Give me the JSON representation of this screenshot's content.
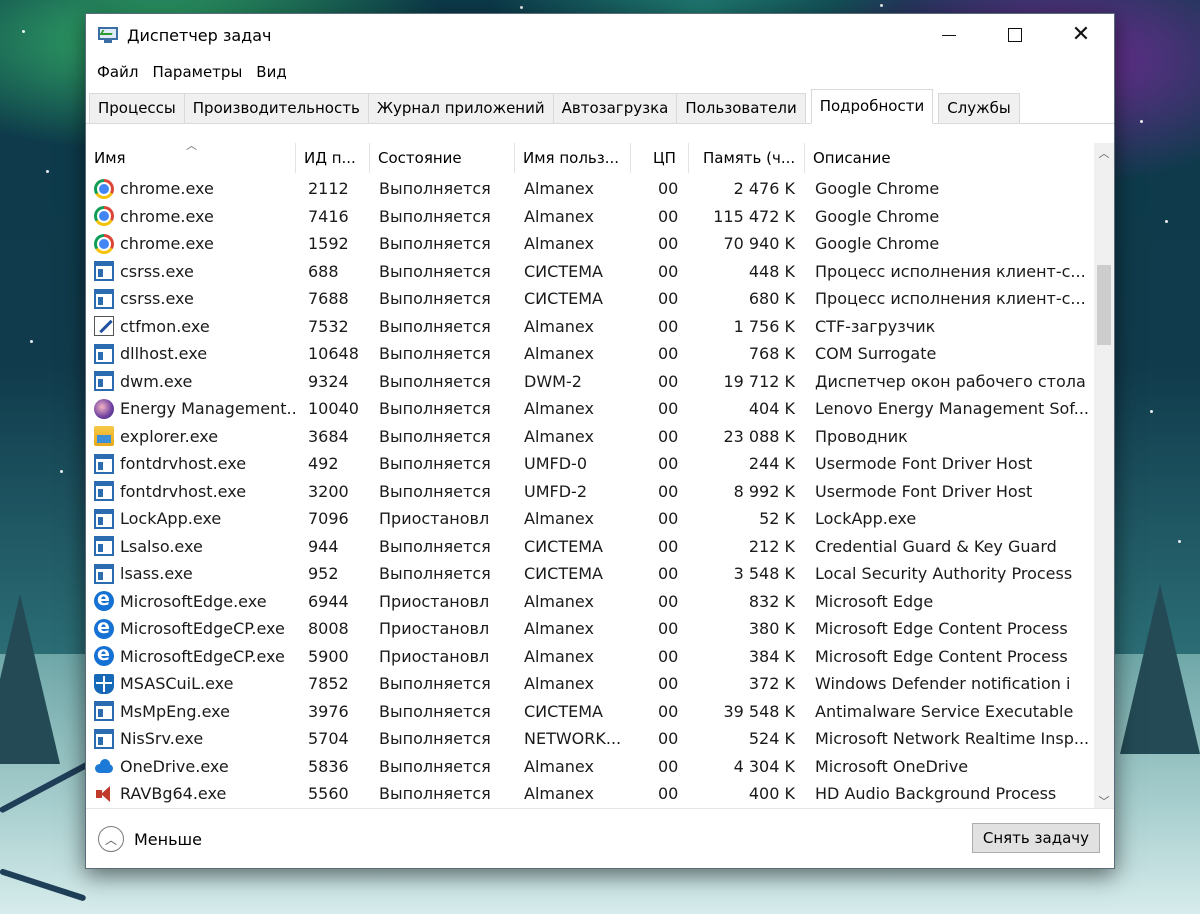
{
  "window": {
    "title": "Диспетчер задач",
    "controls": {
      "minimize": "minimize-icon",
      "maximize": "maximize-icon",
      "close": "close-icon"
    }
  },
  "menu": [
    "Файл",
    "Параметры",
    "Вид"
  ],
  "tabs": [
    {
      "label": "Процессы",
      "active": false
    },
    {
      "label": "Производительность",
      "active": false
    },
    {
      "label": "Журнал приложений",
      "active": false
    },
    {
      "label": "Автозагрузка",
      "active": false
    },
    {
      "label": "Пользователи",
      "active": false
    },
    {
      "label": "Подробности",
      "active": true
    },
    {
      "label": "Службы",
      "active": false
    }
  ],
  "columns": {
    "name": "Имя",
    "pid": "ИД п...",
    "state": "Состояние",
    "user": "Имя польз...",
    "cpu": "ЦП",
    "memory": "Память (ч...",
    "description": "Описание"
  },
  "processes": [
    {
      "icon": "chrome-icon",
      "name": "chrome.exe",
      "pid": "2112",
      "state": "Выполняется",
      "user": "Almanex",
      "cpu": "00",
      "memory": "2 476 K",
      "description": "Google Chrome"
    },
    {
      "icon": "chrome-icon",
      "name": "chrome.exe",
      "pid": "7416",
      "state": "Выполняется",
      "user": "Almanex",
      "cpu": "00",
      "memory": "115 472 K",
      "description": "Google Chrome"
    },
    {
      "icon": "chrome-icon",
      "name": "chrome.exe",
      "pid": "1592",
      "state": "Выполняется",
      "user": "Almanex",
      "cpu": "00",
      "memory": "70 940 K",
      "description": "Google Chrome"
    },
    {
      "icon": "window-icon",
      "name": "csrss.exe",
      "pid": "688",
      "state": "Выполняется",
      "user": "СИСТЕМА",
      "cpu": "00",
      "memory": "448 K",
      "description": "Процесс исполнения клиент-с..."
    },
    {
      "icon": "window-icon",
      "name": "csrss.exe",
      "pid": "7688",
      "state": "Выполняется",
      "user": "СИСТЕМА",
      "cpu": "00",
      "memory": "680 K",
      "description": "Процесс исполнения клиент-с..."
    },
    {
      "icon": "ctfmon-icon",
      "name": "ctfmon.exe",
      "pid": "7532",
      "state": "Выполняется",
      "user": "Almanex",
      "cpu": "00",
      "memory": "1 756 K",
      "description": "CTF-загрузчик"
    },
    {
      "icon": "window-icon",
      "name": "dllhost.exe",
      "pid": "10648",
      "state": "Выполняется",
      "user": "Almanex",
      "cpu": "00",
      "memory": "768 K",
      "description": "COM Surrogate"
    },
    {
      "icon": "window-icon",
      "name": "dwm.exe",
      "pid": "9324",
      "state": "Выполняется",
      "user": "DWM-2",
      "cpu": "00",
      "memory": "19 712 K",
      "description": "Диспетчер окон рабочего стола"
    },
    {
      "icon": "energy-icon",
      "name": "Energy Management...",
      "pid": "10040",
      "state": "Выполняется",
      "user": "Almanex",
      "cpu": "00",
      "memory": "404 K",
      "description": "Lenovo Energy Management Sof..."
    },
    {
      "icon": "explorer-icon",
      "name": "explorer.exe",
      "pid": "3684",
      "state": "Выполняется",
      "user": "Almanex",
      "cpu": "00",
      "memory": "23 088 K",
      "description": "Проводник"
    },
    {
      "icon": "window-icon",
      "name": "fontdrvhost.exe",
      "pid": "492",
      "state": "Выполняется",
      "user": "UMFD-0",
      "cpu": "00",
      "memory": "244 K",
      "description": "Usermode Font Driver Host"
    },
    {
      "icon": "window-icon",
      "name": "fontdrvhost.exe",
      "pid": "3200",
      "state": "Выполняется",
      "user": "UMFD-2",
      "cpu": "00",
      "memory": "8 992 K",
      "description": "Usermode Font Driver Host"
    },
    {
      "icon": "window-icon",
      "name": "LockApp.exe",
      "pid": "7096",
      "state": "Приостановл",
      "user": "Almanex",
      "cpu": "00",
      "memory": "52 K",
      "description": "LockApp.exe"
    },
    {
      "icon": "window-icon",
      "name": "Lsalso.exe",
      "pid": "944",
      "state": "Выполняется",
      "user": "СИСТЕМА",
      "cpu": "00",
      "memory": "212 K",
      "description": "Credential Guard & Key Guard"
    },
    {
      "icon": "window-icon",
      "name": "lsass.exe",
      "pid": "952",
      "state": "Выполняется",
      "user": "СИСТЕМА",
      "cpu": "00",
      "memory": "3 548 K",
      "description": "Local Security Authority Process"
    },
    {
      "icon": "edge-icon",
      "name": "MicrosoftEdge.exe",
      "pid": "6944",
      "state": "Приостановл",
      "user": "Almanex",
      "cpu": "00",
      "memory": "832 K",
      "description": "Microsoft Edge"
    },
    {
      "icon": "edge-icon",
      "name": "MicrosoftEdgeCP.exe",
      "pid": "8008",
      "state": "Приостановл",
      "user": "Almanex",
      "cpu": "00",
      "memory": "380 K",
      "description": "Microsoft Edge Content Process"
    },
    {
      "icon": "edge-icon",
      "name": "MicrosoftEdgeCP.exe",
      "pid": "5900",
      "state": "Приостановл",
      "user": "Almanex",
      "cpu": "00",
      "memory": "384 K",
      "description": "Microsoft Edge Content Process"
    },
    {
      "icon": "defender-icon",
      "name": "MSASCuiL.exe",
      "pid": "7852",
      "state": "Выполняется",
      "user": "Almanex",
      "cpu": "00",
      "memory": "372 K",
      "description": "Windows Defender notification i"
    },
    {
      "icon": "window-icon",
      "name": "MsMpEng.exe",
      "pid": "3976",
      "state": "Выполняется",
      "user": "СИСТЕМА",
      "cpu": "00",
      "memory": "39 548 K",
      "description": "Antimalware Service Executable"
    },
    {
      "icon": "window-icon",
      "name": "NisSrv.exe",
      "pid": "5704",
      "state": "Выполняется",
      "user": "NETWORK...",
      "cpu": "00",
      "memory": "524 K",
      "description": "Microsoft Network Realtime Insp..."
    },
    {
      "icon": "onedrive-icon",
      "name": "OneDrive.exe",
      "pid": "5836",
      "state": "Выполняется",
      "user": "Almanex",
      "cpu": "00",
      "memory": "4 304 K",
      "description": "Microsoft OneDrive"
    },
    {
      "icon": "speaker-icon",
      "name": "RAVBg64.exe",
      "pid": "5560",
      "state": "Выполняется",
      "user": "Almanex",
      "cpu": "00",
      "memory": "400 K",
      "description": "HD Audio Background Process"
    }
  ],
  "footer": {
    "less_label": "Меньше",
    "end_task_label": "Снять задачу"
  }
}
